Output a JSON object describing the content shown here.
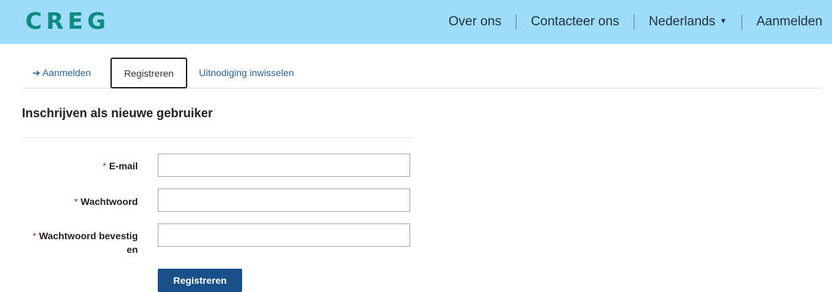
{
  "brand": {
    "logo": "CREG",
    "color": "#0f8a80"
  },
  "nav": {
    "about": "Over ons",
    "contact": "Contacteer ons",
    "language": "Nederlands",
    "signin": "Aanmelden"
  },
  "tabs": {
    "login": "Aanmelden",
    "register": "Registreren",
    "invite": "Uitnodiging inwisselen"
  },
  "form": {
    "title": "Inschrijven als nieuwe gebruiker",
    "required_marker": "*",
    "email_label": "E-mail",
    "password_label": "Wachtwoord",
    "confirm_label_line1": "Wachtwoord bevestig",
    "confirm_label_line2": "en",
    "email_value": "",
    "password_value": "",
    "confirm_value": "",
    "submit": "Registreren"
  },
  "colors": {
    "navbar": "#9fdcf9",
    "button": "#1b4f8a",
    "link": "#2a6496",
    "required": "#b03030"
  }
}
